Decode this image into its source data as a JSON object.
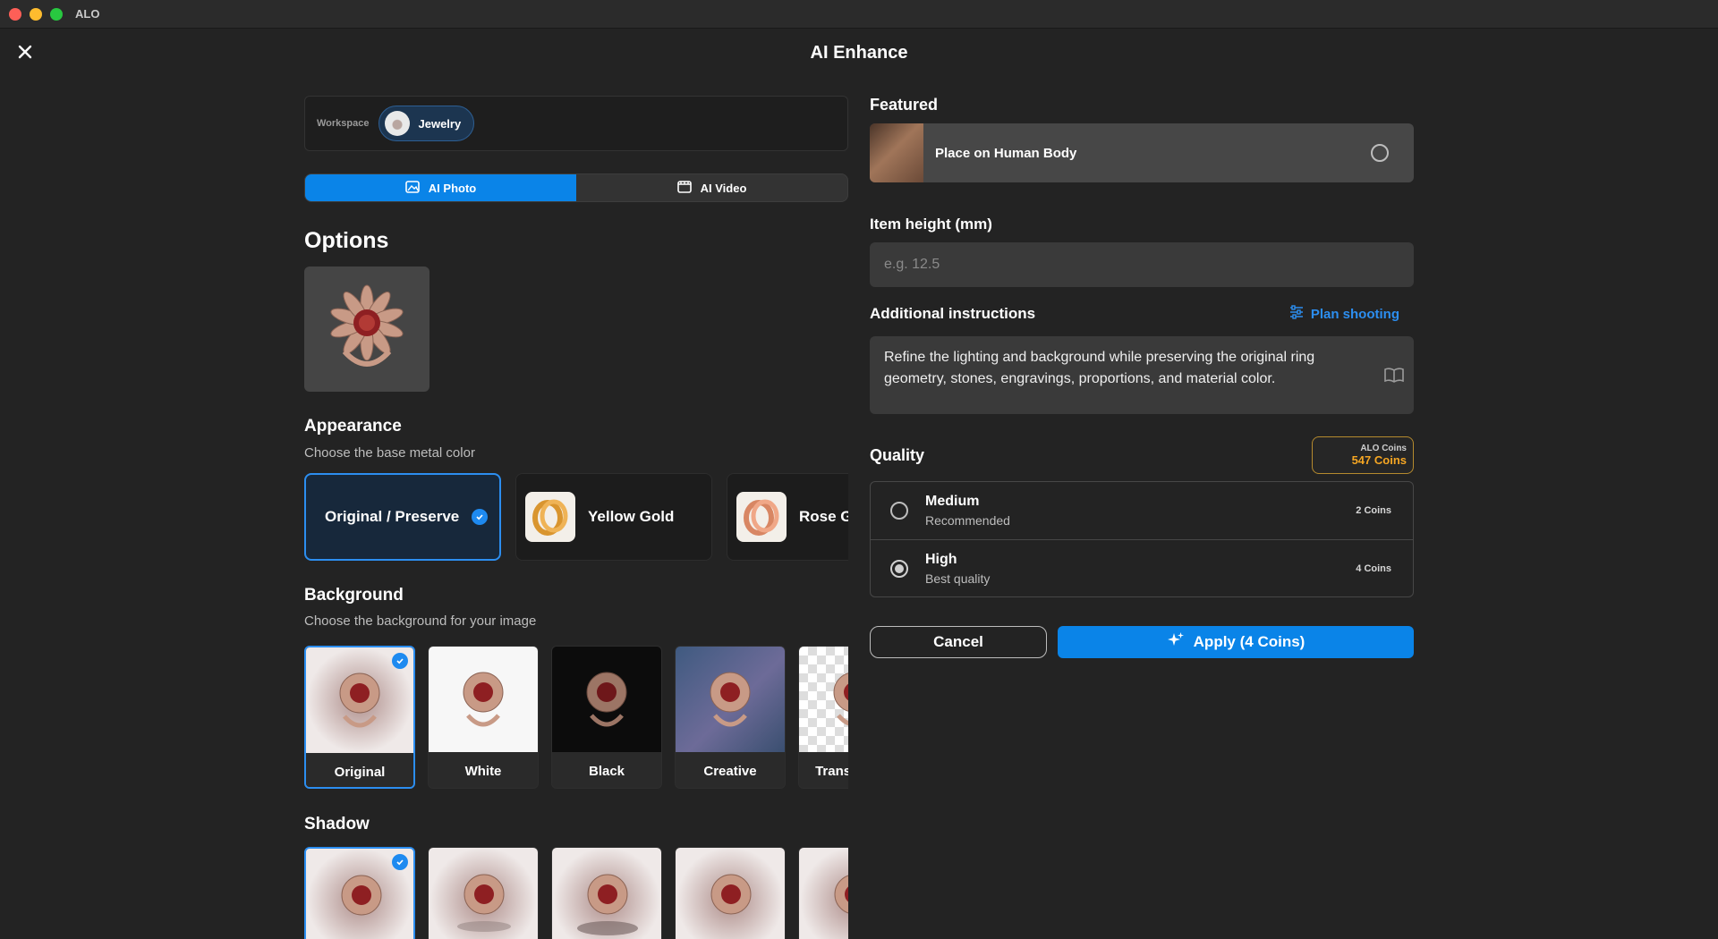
{
  "window": {
    "app_name": "ALO"
  },
  "page": {
    "title": "AI Enhance"
  },
  "workspace": {
    "label": "Workspace",
    "chip": "Jewelry"
  },
  "tabs": [
    {
      "label": "AI Photo",
      "active": true
    },
    {
      "label": "AI Video",
      "active": false
    }
  ],
  "options": {
    "title": "Options",
    "appearance": {
      "title": "Appearance",
      "subtitle": "Choose the base metal color",
      "items": [
        {
          "label": "Original / Preserve",
          "selected": true
        },
        {
          "label": "Yellow Gold",
          "selected": false
        },
        {
          "label": "Rose Gold",
          "selected": false
        }
      ]
    },
    "background": {
      "title": "Background",
      "subtitle": "Choose the background for your image",
      "items": [
        {
          "label": "Original",
          "selected": true
        },
        {
          "label": "White",
          "selected": false
        },
        {
          "label": "Black",
          "selected": false
        },
        {
          "label": "Creative",
          "selected": false
        },
        {
          "label": "Transparent",
          "selected": false
        }
      ]
    },
    "shadow": {
      "title": "Shadow"
    }
  },
  "featured": {
    "title": "Featured",
    "item_label": "Place on Human Body"
  },
  "item_height": {
    "label": "Item height (mm)",
    "placeholder": "e.g. 12.5"
  },
  "instructions": {
    "label": "Additional instructions",
    "link": "Plan shooting",
    "value": "Refine the lighting and background while preserving the original ring geometry, stones, engravings, proportions, and material color."
  },
  "quality": {
    "title": "Quality",
    "coins_label": "ALO Coins",
    "coins_value": "547 Coins",
    "options": [
      {
        "title": "Medium",
        "subtitle": "Recommended",
        "cost": "2 Coins",
        "selected": false
      },
      {
        "title": "High",
        "subtitle": "Best quality",
        "cost": "4 Coins",
        "selected": true
      }
    ]
  },
  "buttons": {
    "cancel": "Cancel",
    "apply": "Apply (4 Coins)"
  },
  "colors": {
    "accent": "#0a84e8",
    "coins": "#f5a623",
    "background": "#232323"
  }
}
